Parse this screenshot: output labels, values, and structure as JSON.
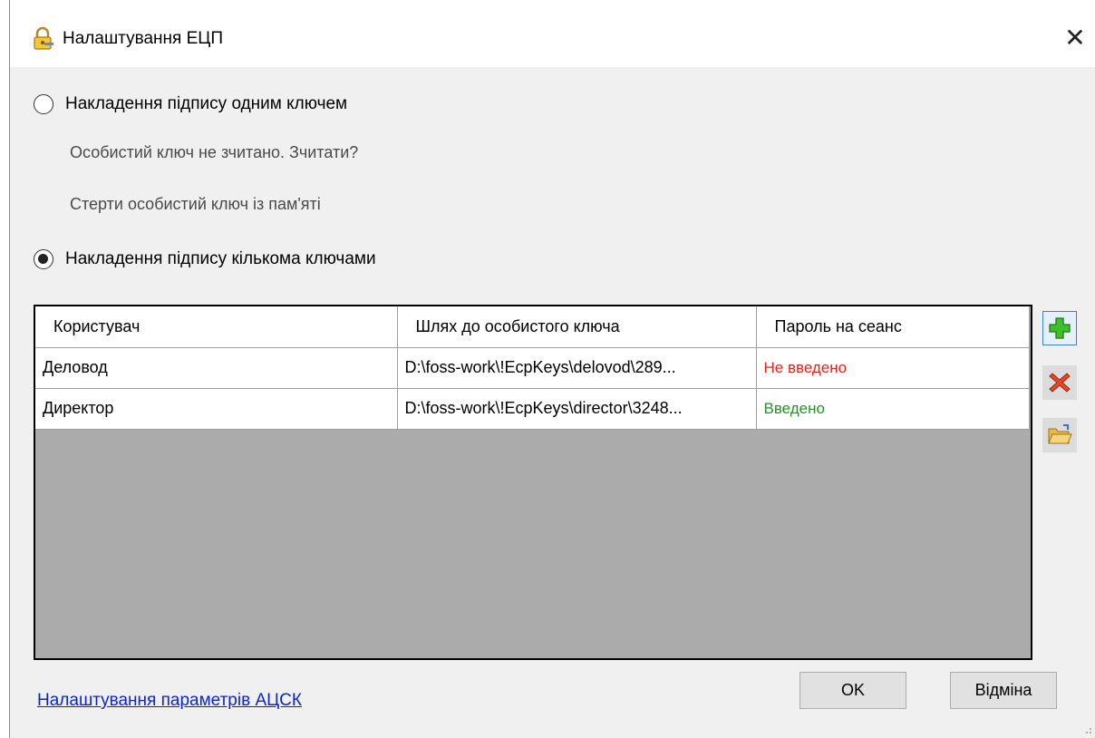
{
  "window": {
    "title": "Налаштування ЕЦП",
    "close_glyph": "✕"
  },
  "mode_single": {
    "label": "Накладення підпису одним ключем",
    "checked": false,
    "read_key_link": "Особистий ключ не зчитано. Зчитати?",
    "erase_key_link": "Стерти особистий ключ із пам'яті"
  },
  "mode_multi": {
    "label": "Накладення підпису кількома ключами",
    "checked": true
  },
  "keys_table": {
    "columns": [
      "Користувач",
      "Шлях до особистого ключа",
      "Пароль на сеанс"
    ],
    "rows": [
      {
        "user": "Деловод",
        "path": "D:\\foss-work\\!EcpKeys\\delovod\\289...",
        "password": "Не введено",
        "status": "bad"
      },
      {
        "user": "Директор",
        "path": "D:\\foss-work\\!EcpKeys\\director\\3248...",
        "password": "Введено",
        "status": "ok"
      }
    ]
  },
  "side_toolbar": {
    "add_icon": "green-plus-icon",
    "remove_icon": "red-x-icon",
    "open_icon": "open-folder-icon"
  },
  "footer": {
    "asck_link": "Налаштування параметрів АЦСК",
    "ok_label": "OK",
    "cancel_label": "Відміна"
  },
  "colors": {
    "status_bad": "#e8201a",
    "status_ok": "#1a9a1a",
    "link": "#0b24d8",
    "grid_empty": "#ababab"
  }
}
